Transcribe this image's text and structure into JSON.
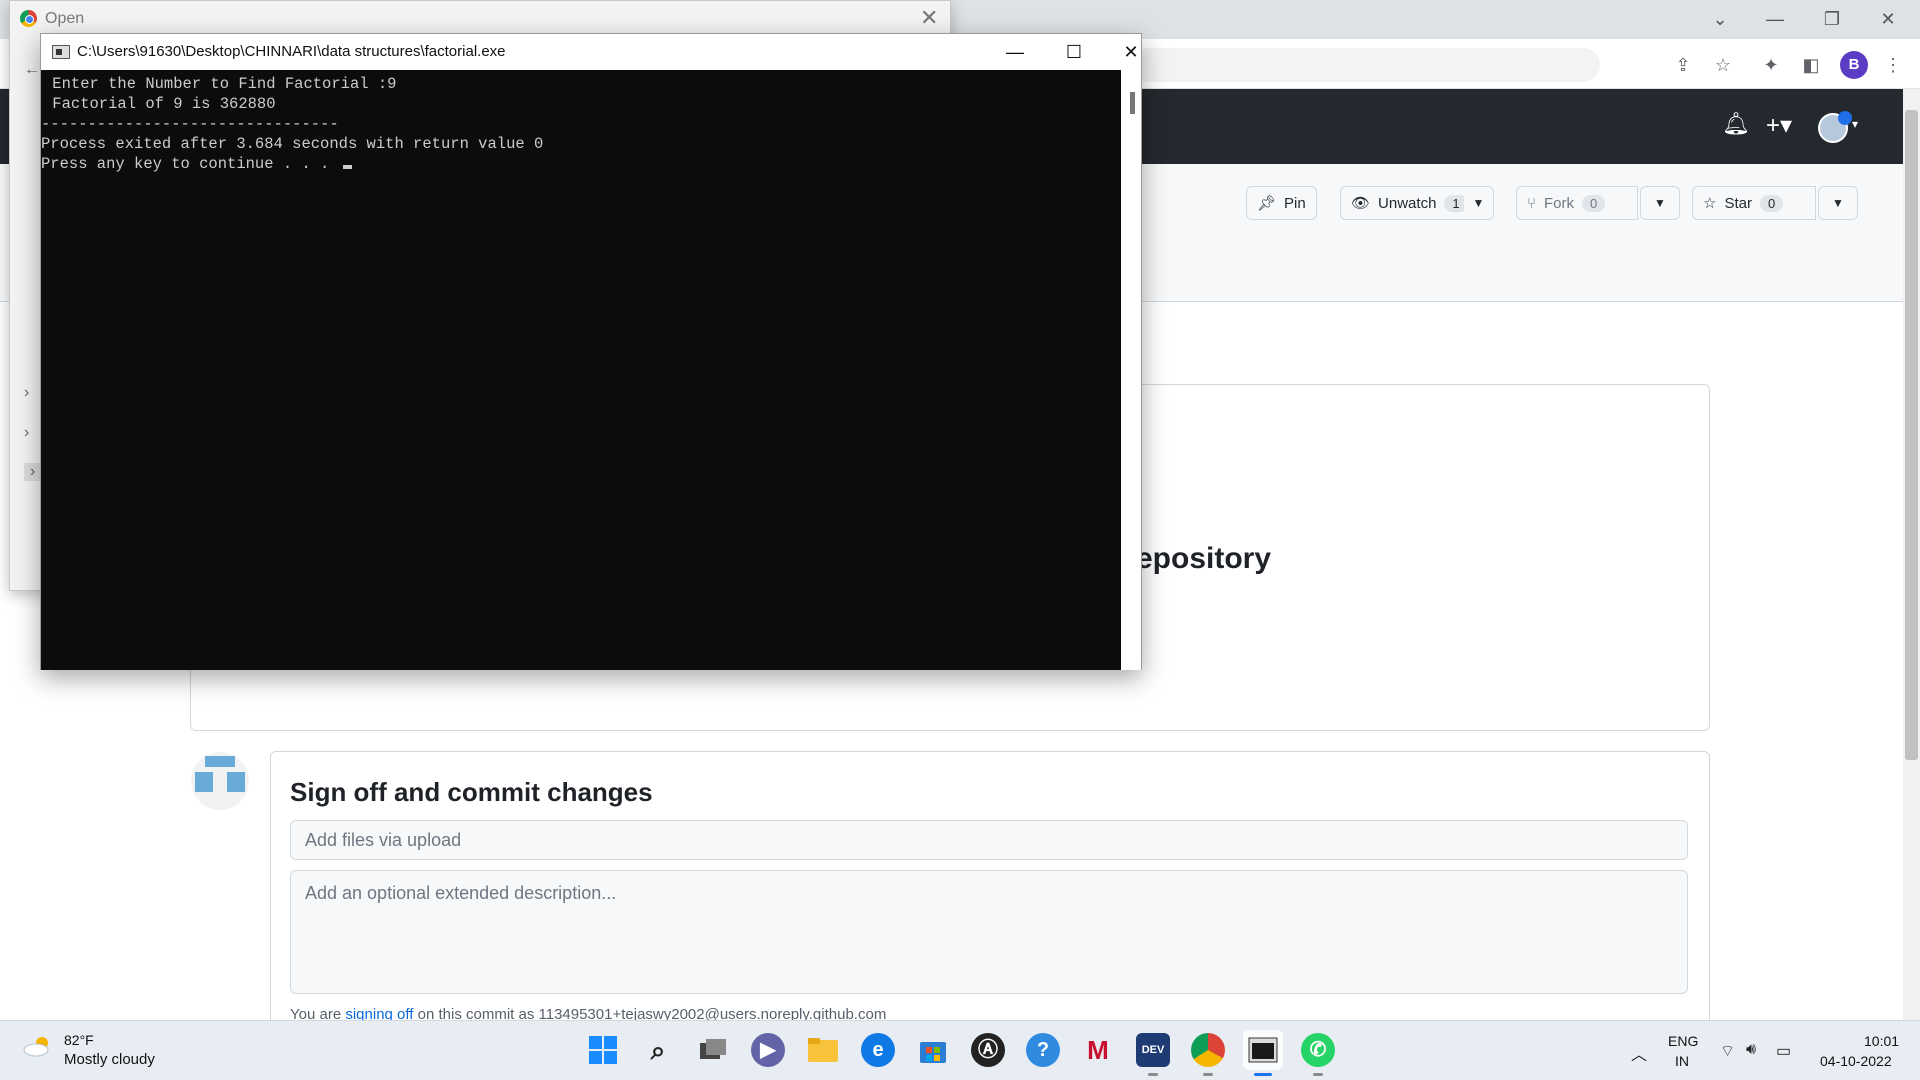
{
  "browser": {
    "open_dialog_title": "Open",
    "profile_letter": "B"
  },
  "github": {
    "actions": {
      "pin": "Pin",
      "unwatch": "Unwatch",
      "unwatch_count": "1",
      "fork": "Fork",
      "fork_count": "0",
      "star": "Star",
      "star_count": "0"
    },
    "upload_title_fragment": "epository",
    "commit": {
      "title": "Sign off and commit changes",
      "summary_placeholder": "Add files via upload",
      "description_placeholder": "Add an optional extended description...",
      "note_prefix": "You are",
      "note_link": "signing off",
      "note_suffix": "on this commit as 113495301+tejaswy2002@users.noreply.github.com"
    }
  },
  "console": {
    "title": "C:\\Users\\91630\\Desktop\\CHINNARI\\data structures\\factorial.exe",
    "lines": [
      " Enter the Number to Find Factorial :9",
      " Factorial of 9 is 362880",
      "--------------------------------",
      "Process exited after 3.684 seconds with return value 0",
      "Press any key to continue . . . "
    ]
  },
  "taskbar": {
    "weather_temp": "82°F",
    "weather_desc": "Mostly cloudy",
    "lang_top": "ENG",
    "lang_bottom": "IN",
    "time": "10:01",
    "date": "04-10-2022",
    "apps": [
      "start-icon",
      "search-icon",
      "task-view-icon",
      "teams-chat-icon",
      "file-explorer-icon",
      "edge-icon",
      "microsoft-store-icon",
      "app-circle-icon",
      "help-icon",
      "mcafee-icon",
      "devcpp-icon",
      "chrome-icon",
      "console-app-icon",
      "whatsapp-icon"
    ]
  },
  "colors": {
    "github_header": "#24292f",
    "console_bg": "#0c0c0c",
    "console_text": "#cccccc",
    "link": "#0969da",
    "taskbar": "#e8edf3"
  }
}
